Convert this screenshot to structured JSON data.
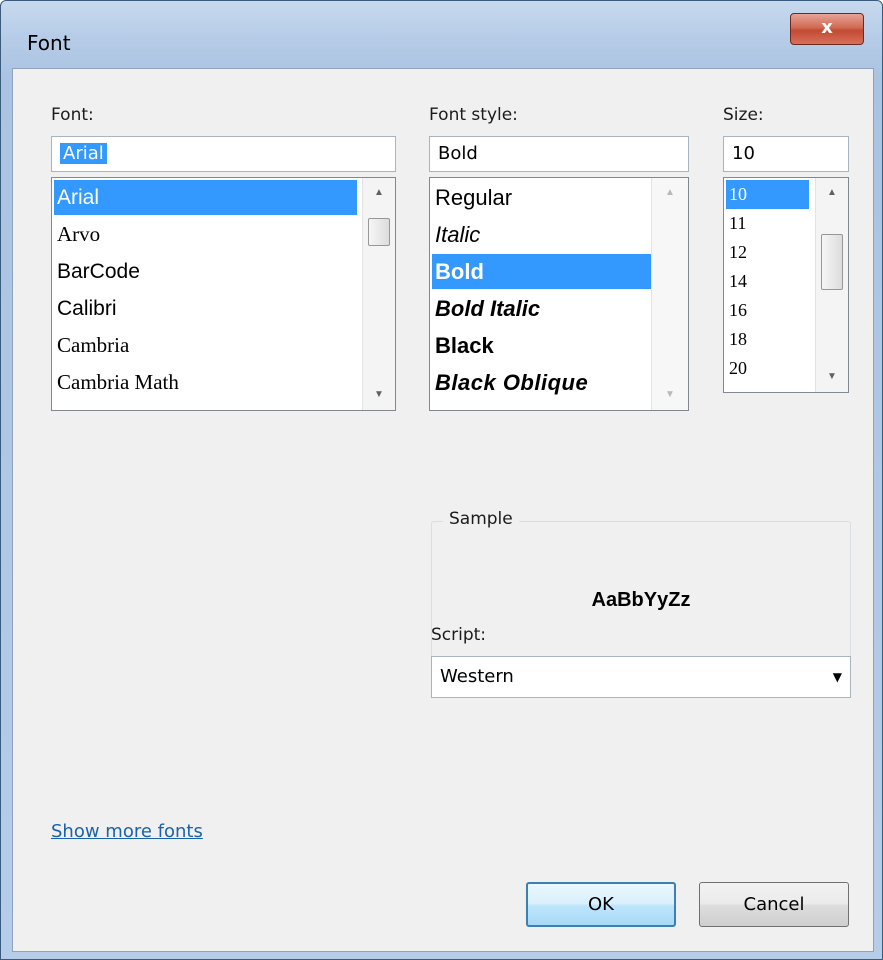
{
  "window": {
    "title": "Font",
    "close_label": "x"
  },
  "font": {
    "label": "Font:",
    "value": "Arial",
    "items": [
      "Arial",
      "Arvo",
      "BarCode",
      "Calibri",
      "Cambria",
      "Cambria Math"
    ],
    "selected_index": 0
  },
  "style": {
    "label": "Font style:",
    "value": "Bold",
    "items": [
      "Regular",
      "Italic",
      "Bold",
      "Bold Italic",
      "Black",
      "Black Oblique"
    ],
    "selected_index": 2
  },
  "size": {
    "label": "Size:",
    "value": "10",
    "items": [
      "10",
      "11",
      "12",
      "14",
      "16",
      "18",
      "20"
    ],
    "selected_index": 0
  },
  "sample": {
    "label": "Sample",
    "text": "AaBbYyZz"
  },
  "script": {
    "label": "Script:",
    "value": "Western"
  },
  "link": "Show more fonts",
  "buttons": {
    "ok": "OK",
    "cancel": "Cancel"
  },
  "colors": {
    "selection": "#3399ff",
    "link": "#1a62ad",
    "dialog_bg": "#f0f0f0"
  },
  "icons": {
    "scroll_up": "triangle-up-icon",
    "scroll_down": "triangle-down-icon",
    "combo_arrow": "chevron-down-icon"
  }
}
